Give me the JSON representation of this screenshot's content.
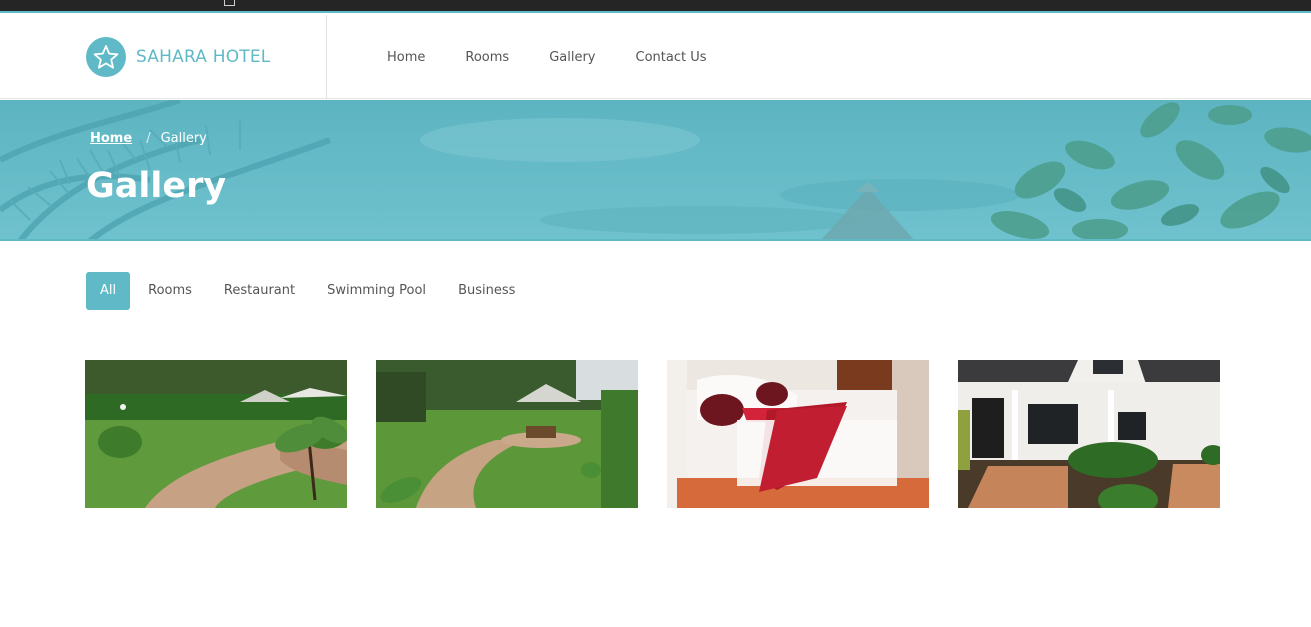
{
  "brand": {
    "name": "SAHARA HOTEL",
    "logo_icon": "star-icon",
    "accent": "#5fb9c6"
  },
  "nav": {
    "items": [
      {
        "label": "Home"
      },
      {
        "label": "Rooms"
      },
      {
        "label": "Gallery"
      },
      {
        "label": "Contact Us"
      }
    ]
  },
  "hero": {
    "breadcrumb": {
      "home": "Home",
      "separator": "/",
      "current": "Gallery"
    },
    "title": "Gallery"
  },
  "filters": [
    {
      "label": "All",
      "active": true
    },
    {
      "label": "Rooms"
    },
    {
      "label": "Restaurant"
    },
    {
      "label": "Swimming Pool"
    },
    {
      "label": "Business"
    }
  ],
  "gallery": [
    {
      "subject": "garden-path-photo"
    },
    {
      "subject": "garden-tables-photo"
    },
    {
      "subject": "hotel-bedroom-photo"
    },
    {
      "subject": "hotel-building-photo"
    }
  ]
}
